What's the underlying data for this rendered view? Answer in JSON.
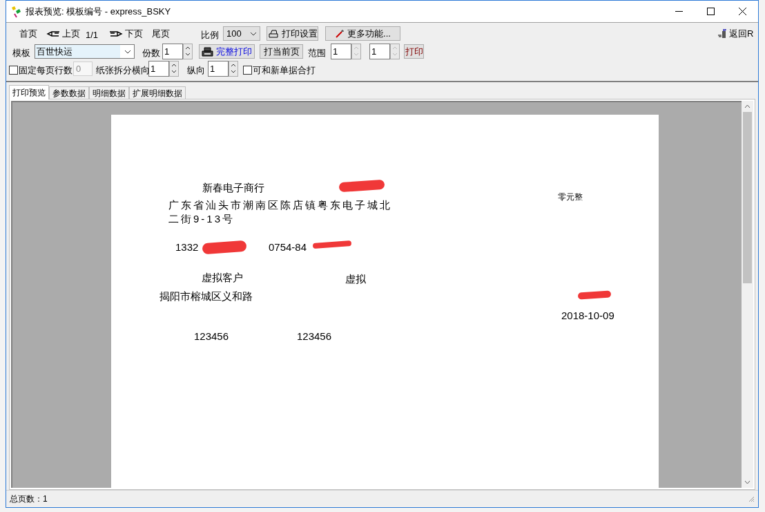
{
  "window": {
    "title": "报表预览: 模板编号 - express_BSKY"
  },
  "toolbar": {
    "first_page": "首页",
    "prev_page": "上页",
    "page_counter": "1/1",
    "next_page": "下页",
    "last_page": "尾页",
    "scale_label": "比例",
    "scale_value": "100",
    "print_setup": "打印设置",
    "more": "更多功能...",
    "back": "返回R"
  },
  "options": {
    "template_label": "模板",
    "template_value": "百世快运",
    "copies_label": "份数",
    "copies_value": "1",
    "full_print": "完整打印",
    "print_current": "打当前页",
    "range_label": "范围",
    "range_from": "1",
    "range_to": "1",
    "print": "打印"
  },
  "split": {
    "fixed_rows": {
      "label": "固定每页行数",
      "checked": false
    },
    "rows_value": "0",
    "horizontal_label": "纸张拆分横向",
    "horizontal_value": "1",
    "vertical_label": "纵向",
    "vertical_value": "1",
    "merge": {
      "label": "可和新单据合打",
      "checked": false
    }
  },
  "tabs": [
    {
      "label": "打印预览",
      "selected": true
    },
    {
      "label": "参数数据",
      "selected": false
    },
    {
      "label": "明细数据",
      "selected": false
    },
    {
      "label": "扩展明细数据",
      "selected": false
    }
  ],
  "page_fields": [
    {
      "text": "新春电子商行",
      "kind": "normal"
    },
    {
      "text": "广东省汕头市潮南区陈店镇粤东电子城北二街9-13号",
      "kind": "address"
    },
    {
      "text": "1332",
      "kind": "normal"
    },
    {
      "text": "0754-84",
      "kind": "normal"
    },
    {
      "text": "虚拟客户",
      "kind": "normal"
    },
    {
      "text": "虚拟",
      "kind": "normal"
    },
    {
      "text": "揭阳市榕城区义和路",
      "kind": "normal"
    },
    {
      "text": "123456",
      "kind": "normal"
    },
    {
      "text": "123456",
      "kind": "normal"
    },
    {
      "text": "零元整",
      "kind": "small"
    },
    {
      "text": "2018-10-09",
      "kind": "normal"
    }
  ],
  "status_bar": {
    "text": "总页数：1"
  }
}
